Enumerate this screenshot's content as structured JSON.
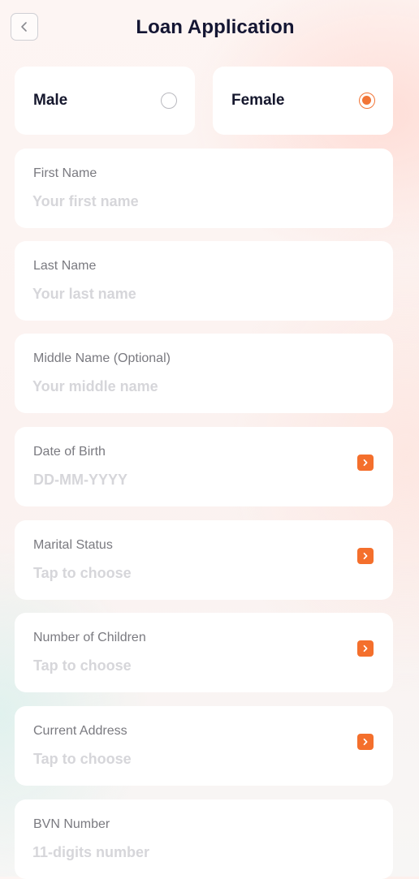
{
  "header": {
    "title": "Loan Application",
    "back_icon": "chevron-left-icon"
  },
  "gender": {
    "options": [
      {
        "label": "Male",
        "selected": false
      },
      {
        "label": "Female",
        "selected": true
      }
    ]
  },
  "fields": [
    {
      "label": "First Name",
      "placeholder": "Your first name",
      "type": "text"
    },
    {
      "label": "Last Name",
      "placeholder": "Your last name",
      "type": "text"
    },
    {
      "label": "Middle Name (Optional)",
      "placeholder": "Your middle name",
      "type": "text"
    },
    {
      "label": "Date of Birth",
      "value": "DD-MM-YYYY",
      "type": "select"
    },
    {
      "label": "Marital Status",
      "value": "Tap to choose",
      "type": "select"
    },
    {
      "label": "Number of Children",
      "value": "Tap to choose",
      "type": "select"
    },
    {
      "label": "Current Address",
      "value": "Tap to choose",
      "type": "select"
    },
    {
      "label": "BVN Number",
      "placeholder": "11-digits number",
      "type": "text"
    }
  ],
  "colors": {
    "accent": "#f46f2c",
    "title": "#141633",
    "label": "#7a7a80",
    "placeholder": "#d6d6da"
  }
}
